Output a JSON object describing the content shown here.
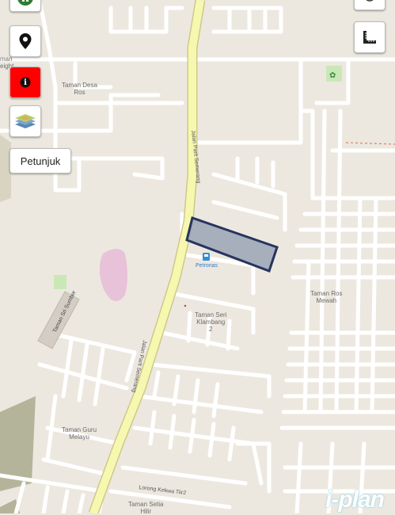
{
  "controls": {
    "hint_label": "Petunjuk",
    "info_glyph": "i",
    "location_icon": "map-pin-icon",
    "layers_icon": "layers-icon",
    "measure_icon": "ruler-square-icon",
    "top_left_icon": "pause-icon",
    "top_right_icon": "compass-icon",
    "info_color": "#ff0000"
  },
  "labels": {
    "taman_heights_1": "man",
    "taman_heights_2": "eight",
    "taman_desa_ros_1": "Taman Desa",
    "taman_desa_ros_2": "Ros",
    "jalan_parit_1": "Jalan Parit Semerang",
    "jalan_parit_2": "Jalan Parit Semerang",
    "petronas": "Petronas",
    "taman_seri_klambang_1": "Taman Seri",
    "taman_seri_klambang_2": "Klambang",
    "taman_seri_klambang_3": "2",
    "taman_ros_mewah_1": "Taman Ros",
    "taman_ros_mewah_2": "Mewah",
    "taman_sri_sumber": "Taman Sri Sumber",
    "taman_guru_1": "Taman Guru",
    "taman_guru_2": "Melayu",
    "lorong_kekwa": "Lorong Kekwa Tiir2",
    "taman_setia_1": "Taman Setia",
    "taman_setia_2": "Hilir"
  },
  "brand": {
    "name": "i-plan"
  },
  "colors": {
    "land": "#ede8df",
    "road": "#ffffff",
    "main_road": "#f7f8b0",
    "main_road_edge": "#d4d08a",
    "highlight_fill": "#9aa3b6",
    "highlight_stroke": "#26345f",
    "park": "#c9e8b5",
    "pink_area": "#e8c2d8",
    "grass": "#b8b8a0"
  }
}
